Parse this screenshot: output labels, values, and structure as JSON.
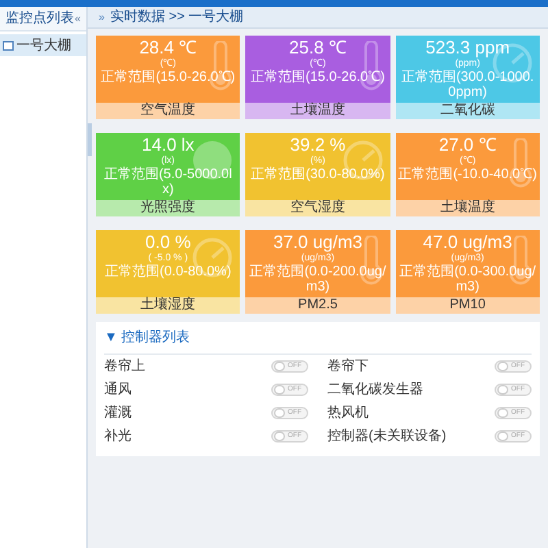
{
  "sidebar": {
    "title": "监控点列表",
    "collapse": "«",
    "items": [
      {
        "label": "一号大棚",
        "selected": true
      }
    ]
  },
  "breadcrumb": {
    "icon": "»",
    "text": "实时数据 >> 一号大棚"
  },
  "cards": [
    {
      "value": "28.4 ℃",
      "unit": "(℃)",
      "range": "正常范围(15.0-26.0℃)",
      "sensor_name": "空气温度",
      "color": "#fb9a3c",
      "kind": "thermometer"
    },
    {
      "value": "25.8 ℃",
      "unit": "(℃)",
      "range": "正常范围(15.0-26.0℃)",
      "sensor_name": "土壤温度",
      "color": "#a95ee0",
      "kind": "thermometer"
    },
    {
      "value": "523.3 ppm",
      "unit": "(ppm)",
      "range": "正常范围(300.0-1000.0ppm)",
      "sensor_name": "二氧化碳",
      "color": "#4dc8e6",
      "kind": "gauge"
    },
    {
      "value": "14.0 lx",
      "unit": "(lx)",
      "range": "正常范围(5.0-5000.0lx)",
      "sensor_name": "光照强度",
      "color": "#5fd046",
      "kind": "light"
    },
    {
      "value": "39.2 %",
      "unit": "(%)",
      "range": "正常范围(30.0-80.0%)",
      "sensor_name": "空气湿度",
      "color": "#f1c230",
      "kind": "gauge"
    },
    {
      "value": "27.0 ℃",
      "unit": "(℃)",
      "range": "正常范围(-10.0-40.0℃)",
      "sensor_name": "土壤温度",
      "color": "#fb9a3c",
      "kind": "thermometer"
    },
    {
      "value": "0.0 %",
      "unit": "( -5.0 % )",
      "range": "正常范围(0.0-80.0%)",
      "sensor_name": "土壤湿度",
      "color": "#f1c230",
      "kind": "gauge"
    },
    {
      "value": "37.0 ug/m3",
      "unit": "(ug/m3)",
      "range": "正常范围(0.0-200.0ug/m3)",
      "sensor_name": "PM2.5",
      "color": "#fb9a3c",
      "kind": "thermometer"
    },
    {
      "value": "47.0 ug/m3",
      "unit": "(ug/m3)",
      "range": "正常范围(0.0-300.0ug/m3)",
      "sensor_name": "PM10",
      "color": "#fb9a3c",
      "kind": "thermometer"
    }
  ],
  "controls": {
    "title": "▼ 控制器列表",
    "items": [
      {
        "name": "卷帘上",
        "on": false,
        "state": "OFF"
      },
      {
        "name": "卷帘下",
        "on": false,
        "state": "OFF"
      },
      {
        "name": "通风",
        "on": false,
        "state": "OFF"
      },
      {
        "name": "二氧化碳发生器",
        "on": false,
        "state": "OFF"
      },
      {
        "name": "灌溉",
        "on": false,
        "state": "OFF"
      },
      {
        "name": "热风机",
        "on": false,
        "state": "OFF"
      },
      {
        "name": "补光",
        "on": false,
        "state": "OFF"
      },
      {
        "name": "控制器(未关联设备)",
        "on": false,
        "state": "OFF"
      }
    ]
  }
}
